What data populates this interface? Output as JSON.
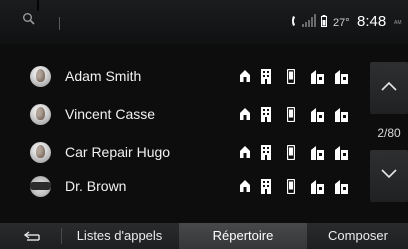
{
  "status": {
    "temperature": "27°",
    "time": "8:48",
    "ampm": "AM"
  },
  "icons": {
    "search": "search-icon",
    "call_status": "phone-icon",
    "signal": "signal-bars-icon",
    "battery": "battery-icon",
    "contact_types": [
      "home-icon",
      "work-icon",
      "mobile-icon",
      "office-icon",
      "office-alt-icon"
    ]
  },
  "contacts": [
    {
      "name": "Adam Smith"
    },
    {
      "name": "Vincent Casse"
    },
    {
      "name": "Car Repair Hugo"
    },
    {
      "name": "Dr. Brown"
    }
  ],
  "pagination": {
    "label": "2/80"
  },
  "tabs": {
    "calls": "Listes d'appels",
    "directory": "Répertoire",
    "compose": "Composer",
    "active": "directory"
  },
  "colors": {
    "background": "#0d0d0e",
    "active_tab": "#404143",
    "text": "#ececec"
  }
}
